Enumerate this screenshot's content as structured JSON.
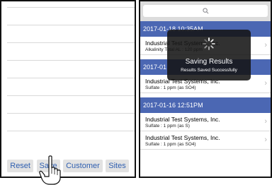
{
  "left_screen": {
    "toolbar": {
      "reset_label": "Reset",
      "save_label": "Save",
      "customer_label": "Customer",
      "sites_label": "Sites"
    }
  },
  "right_screen": {
    "sections": [
      {
        "header": "2017-01-18 10:35AM",
        "items": [
          {
            "title": "Industrial Test Systems, Inc.",
            "subtitle": "Alkalinity Total AL : 120 ppm"
          }
        ]
      },
      {
        "header": "2017-01",
        "items": [
          {
            "title": "Industrial Test Systems, Inc.",
            "subtitle": "Sulfate : 1 ppm (as SO4)"
          }
        ]
      },
      {
        "header": "2017-01-16 12:51PM",
        "items": [
          {
            "title": "Industrial Test Systems, Inc.",
            "subtitle": "Sulfate : 1 ppm (as S)"
          },
          {
            "title": "Industrial Test Systems, Inc.",
            "subtitle": "Sulfate : 1 ppm (as SO4)"
          }
        ]
      }
    ],
    "hud": {
      "title": "Saving Results",
      "message": "Results Saved Successfully"
    }
  },
  "colors": {
    "section_header": "#4b67b3",
    "toolbar_text": "#2f5fb0",
    "hud_background": "#141414"
  },
  "icons": {
    "search": "magnifier-icon",
    "chevron": "chevron-right-icon",
    "spinner": "activity-spinner-icon",
    "pointer": "hand-pointer-icon"
  }
}
